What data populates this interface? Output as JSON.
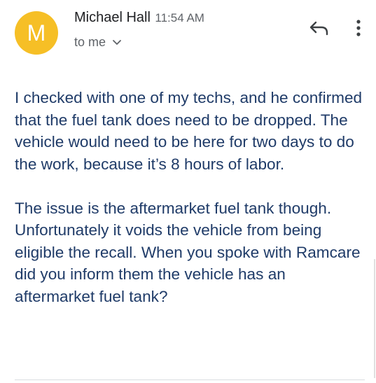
{
  "sender": {
    "avatar_initial": "M",
    "avatar_color": "#f6bf26",
    "name": "Michael Hall",
    "time": "11:54 AM",
    "recipient_label": "to me"
  },
  "actions": {
    "reply_icon": "reply-icon",
    "more_icon": "more-vertical-icon"
  },
  "message": {
    "paragraphs": [
      "I checked with one of my techs, and he confirmed that the fuel tank does need to be dropped. The vehicle would need to be here for two days to do the work, because it’s 8 hours of labor.",
      "The issue is the aftermarket fuel tank though. Unfortunately it voids the vehicle from being eligible the recall. When you spoke with Ramcare did you inform them the vehicle has an aftermarket fuel tank?"
    ]
  },
  "colors": {
    "body_text": "#1f3b68",
    "secondary_text": "#5f6368"
  }
}
